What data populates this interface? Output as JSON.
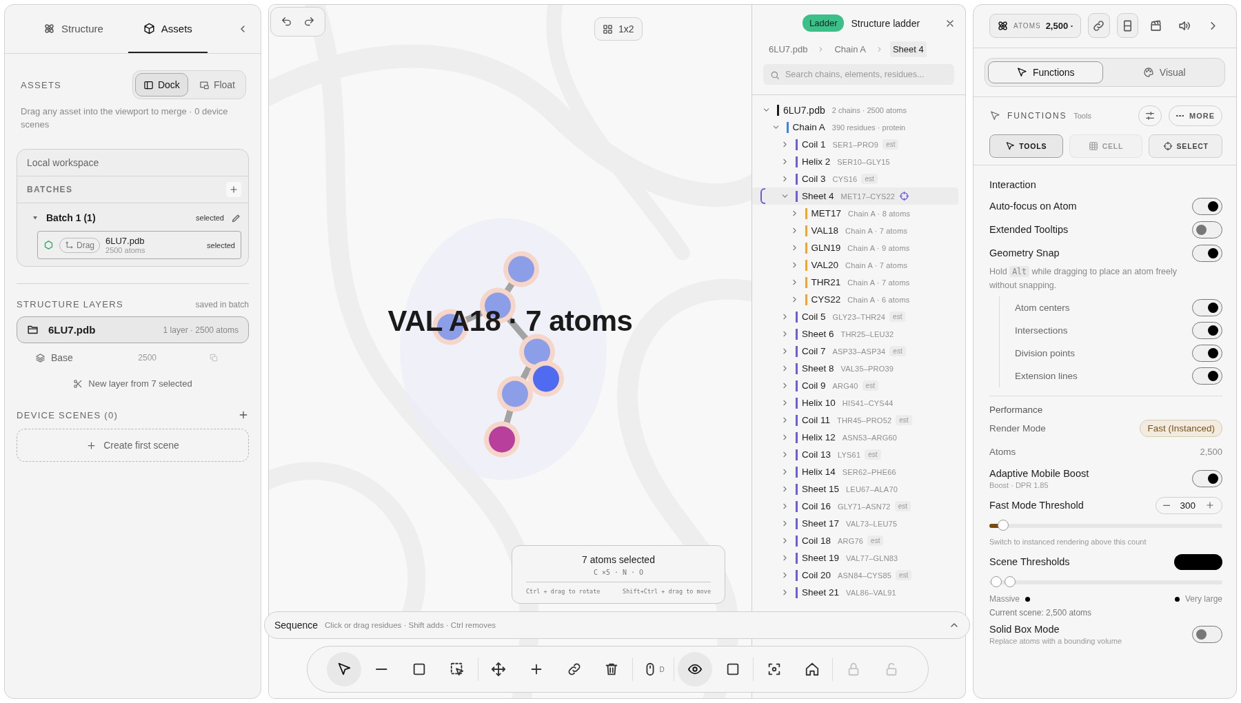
{
  "left_panel": {
    "tabs": [
      {
        "label": "Structure",
        "kind": "atom",
        "selected": false
      },
      {
        "label": "Assets",
        "kind": "cube",
        "selected": true
      }
    ],
    "assets": {
      "title": "ASSETS",
      "modes": [
        {
          "label": "Dock",
          "kind": "dock",
          "selected": true
        },
        {
          "label": "Float",
          "kind": "float",
          "selected": false
        }
      ],
      "description": "Drag any asset into the viewport to merge · 0 device scenes"
    },
    "workspace": {
      "title": "Local workspace",
      "batches_title": "BATCHES",
      "batches": [
        {
          "name": "Batch 1 (1)",
          "expanded": true,
          "status": "selected",
          "files": [
            {
              "name": "6LU7.pdb",
              "atoms": "2500 atoms",
              "drag": "Drag",
              "status": "selected"
            }
          ]
        }
      ]
    },
    "layers": {
      "title": "STRUCTURE LAYERS",
      "note": "saved in batch",
      "file": {
        "name": "6LU7.pdb",
        "meta": "1 layer · 2500 atoms"
      },
      "items": [
        {
          "name": "Base",
          "count": "2500"
        }
      ],
      "action": "New layer from 7 selected"
    },
    "scenes": {
      "title": "DEVICE SCENES (0)",
      "create": "Create first scene"
    }
  },
  "viewport": {
    "layout_button": "1x2",
    "label": "VAL A18 · 7 atoms",
    "selection": {
      "title": "7 atoms selected",
      "elements": "C ×5 · N · O",
      "hints": [
        "Ctrl + drag to rotate",
        "Shift+Ctrl + drag to move"
      ]
    }
  },
  "ladder": {
    "badge": "Ladder",
    "title": "Structure ladder",
    "breadcrumb": [
      {
        "label": "6LU7.pdb",
        "selected": false
      },
      {
        "label": "Chain A",
        "selected": false
      },
      {
        "label": "Sheet 4",
        "selected": true
      }
    ],
    "search_placeholder": "Search chains, elements, residues...",
    "tree": [
      {
        "name": "6LU7.pdb",
        "meta": "2 chains · 2500 atoms",
        "color": "#1a1a1a",
        "expanded": true,
        "selected": false,
        "children": [
          {
            "name": "Chain A",
            "meta": "390 residues · protein",
            "color": "#3b82f6",
            "expanded": true,
            "selected": false,
            "children": [
              {
                "name": "Coil 1",
                "meta": "SER1–PRO9",
                "tag": "est",
                "color": "#6b5fd8",
                "expanded": false,
                "selected": false
              },
              {
                "name": "Helix 2",
                "meta": "SER10–GLY15",
                "color": "#6b5fd8",
                "expanded": false,
                "selected": false
              },
              {
                "name": "Coil 3",
                "meta": "CYS16",
                "tag": "est",
                "color": "#6b5fd8",
                "expanded": false,
                "selected": false
              },
              {
                "name": "Sheet 4",
                "meta": "MET17–CYS22",
                "color": "#6b5fd8",
                "expanded": true,
                "selected": true,
                "children": [
                  {
                    "name": "MET17",
                    "meta": "Chain A · 8 atoms",
                    "color": "#f5a524",
                    "expanded": false,
                    "selected": false
                  },
                  {
                    "name": "VAL18",
                    "meta": "Chain A · 7 atoms",
                    "color": "#f5a524",
                    "expanded": false,
                    "selected": false
                  },
                  {
                    "name": "GLN19",
                    "meta": "Chain A · 9 atoms",
                    "color": "#f5a524",
                    "expanded": false,
                    "selected": false
                  },
                  {
                    "name": "VAL20",
                    "meta": "Chain A · 7 atoms",
                    "color": "#f5a524",
                    "expanded": false,
                    "selected": false
                  },
                  {
                    "name": "THR21",
                    "meta": "Chain A · 7 atoms",
                    "color": "#f5a524",
                    "expanded": false,
                    "selected": false
                  },
                  {
                    "name": "CYS22",
                    "meta": "Chain A · 6 atoms",
                    "color": "#f5a524",
                    "expanded": false,
                    "selected": false
                  }
                ]
              },
              {
                "name": "Coil 5",
                "meta": "GLY23–THR24",
                "tag": "est",
                "color": "#6b5fd8",
                "expanded": false,
                "selected": false
              },
              {
                "name": "Sheet 6",
                "meta": "THR25–LEU32",
                "color": "#6b5fd8",
                "expanded": false,
                "selected": false
              },
              {
                "name": "Coil 7",
                "meta": "ASP33–ASP34",
                "tag": "est",
                "color": "#6b5fd8",
                "expanded": false,
                "selected": false
              },
              {
                "name": "Sheet 8",
                "meta": "VAL35–PRO39",
                "color": "#6b5fd8",
                "expanded": false,
                "selected": false
              },
              {
                "name": "Coil 9",
                "meta": "ARG40",
                "tag": "est",
                "color": "#6b5fd8",
                "expanded": false,
                "selected": false
              },
              {
                "name": "Helix 10",
                "meta": "HIS41–CYS44",
                "color": "#6b5fd8",
                "expanded": false,
                "selected": false
              },
              {
                "name": "Coil 11",
                "meta": "THR45–PRO52",
                "tag": "est",
                "color": "#6b5fd8",
                "expanded": false,
                "selected": false
              },
              {
                "name": "Helix 12",
                "meta": "ASN53–ARG60",
                "color": "#6b5fd8",
                "expanded": false,
                "selected": false
              },
              {
                "name": "Coil 13",
                "meta": "LYS61",
                "tag": "est",
                "color": "#6b5fd8",
                "expanded": false,
                "selected": false
              },
              {
                "name": "Helix 14",
                "meta": "SER62–PHE66",
                "color": "#6b5fd8",
                "expanded": false,
                "selected": false
              },
              {
                "name": "Sheet 15",
                "meta": "LEU67–ALA70",
                "color": "#6b5fd8",
                "expanded": false,
                "selected": false
              },
              {
                "name": "Coil 16",
                "meta": "GLY71–ASN72",
                "tag": "est",
                "color": "#6b5fd8",
                "expanded": false,
                "selected": false
              },
              {
                "name": "Sheet 17",
                "meta": "VAL73–LEU75",
                "color": "#6b5fd8",
                "expanded": false,
                "selected": false
              },
              {
                "name": "Coil 18",
                "meta": "ARG76",
                "tag": "est",
                "color": "#6b5fd8",
                "expanded": false,
                "selected": false
              },
              {
                "name": "Sheet 19",
                "meta": "VAL77–GLN83",
                "color": "#6b5fd8",
                "expanded": false,
                "selected": false
              },
              {
                "name": "Coil 20",
                "meta": "ASN84–CYS85",
                "tag": "est",
                "color": "#6b5fd8",
                "expanded": false,
                "selected": false
              },
              {
                "name": "Sheet 21",
                "meta": "VAL86–VAL91",
                "color": "#6b5fd8",
                "expanded": false,
                "selected": false
              }
            ]
          }
        ]
      }
    ]
  },
  "sequence": {
    "title": "Sequence",
    "hint": "Click or drag residues · Shift adds · Ctrl removes",
    "expanded": false
  },
  "toolbar": {
    "groups": [
      [
        {
          "kind": "pointer",
          "selected": true,
          "disabled": false
        },
        {
          "kind": "line",
          "selected": false,
          "disabled": false
        },
        {
          "kind": "square",
          "selected": false,
          "disabled": false
        },
        {
          "kind": "box-select",
          "selected": false,
          "disabled": false
        }
      ],
      [
        {
          "kind": "move",
          "selected": false,
          "disabled": false
        },
        {
          "kind": "plus",
          "selected": false,
          "disabled": false
        },
        {
          "kind": "link",
          "selected": false,
          "disabled": false
        },
        {
          "kind": "trash",
          "selected": false,
          "disabled": false
        }
      ],
      [
        {
          "kind": "mouse",
          "badge": "D",
          "selected": false,
          "disabled": false
        }
      ],
      [
        {
          "kind": "eye",
          "selected": true,
          "disabled": false
        },
        {
          "kind": "square",
          "selected": false,
          "disabled": false
        }
      ],
      [
        {
          "kind": "focus",
          "selected": false,
          "disabled": false
        },
        {
          "kind": "home",
          "selected": false,
          "disabled": false
        }
      ],
      [
        {
          "kind": "lock",
          "selected": false,
          "disabled": true
        },
        {
          "kind": "unlock",
          "selected": false,
          "disabled": true
        }
      ]
    ]
  },
  "right_panel": {
    "header": {
      "atoms_label": "ATOMS",
      "atoms_value": "2,500 ·",
      "buttons": [
        {
          "kind": "link",
          "selected": true
        },
        {
          "kind": "panel",
          "selected": true
        },
        {
          "kind": "clapper",
          "selected": false
        },
        {
          "kind": "speaker",
          "selected": false
        },
        {
          "kind": "chevron",
          "selected": false
        }
      ]
    },
    "view_tabs": [
      {
        "label": "Functions",
        "kind": "pointer",
        "selected": true
      },
      {
        "label": "Visual",
        "kind": "palette",
        "selected": false
      }
    ],
    "functions": {
      "title": "FUNCTIONS",
      "subtitle": "Tools",
      "more": "MORE",
      "tools": [
        {
          "label": "TOOLS",
          "kind": "pointer",
          "selected": true,
          "disabled": false
        },
        {
          "label": "CELL",
          "kind": "grid",
          "selected": false,
          "disabled": true
        },
        {
          "label": "SELECT",
          "kind": "target",
          "selected": false,
          "disabled": false
        }
      ]
    },
    "interaction": {
      "title": "Interaction",
      "settings": [
        {
          "label": "Auto-focus on Atom",
          "on": true
        },
        {
          "label": "Extended Tooltips",
          "on": false
        },
        {
          "label": "Geometry Snap",
          "on": true
        }
      ],
      "snap_hint": {
        "before": "Hold",
        "key": "Alt",
        "after": "while dragging to place an atom freely without snapping."
      },
      "snap_options": [
        {
          "label": "Atom centers",
          "on": true
        },
        {
          "label": "Intersections",
          "on": true
        },
        {
          "label": "Division points",
          "on": true
        },
        {
          "label": "Extension lines",
          "on": true
        }
      ]
    },
    "performance": {
      "title": "Performance",
      "render_mode": {
        "label": "Render Mode",
        "value": "Fast (Instanced)"
      },
      "atoms": {
        "label": "Atoms",
        "value": "2,500"
      },
      "boost": {
        "label": "Adaptive Mobile Boost",
        "sub": "Boost · DPR 1.85",
        "on": true
      },
      "fast_threshold": {
        "label": "Fast Mode Threshold",
        "value": "300",
        "level": 0.06,
        "hint": "Switch to instanced rendering above this count"
      },
      "scene_thresholds": {
        "label": "Scene Thresholds",
        "thumbs": [
          {
            "level": 0.03
          },
          {
            "level": 0.09
          }
        ],
        "low_label": "Massive",
        "high_label": "Very large",
        "current": "Current scene: 2,500 atoms"
      },
      "solid_box": {
        "label": "Solid Box Mode",
        "on": false,
        "sub": "Replace atoms with a bounding volume"
      }
    }
  }
}
